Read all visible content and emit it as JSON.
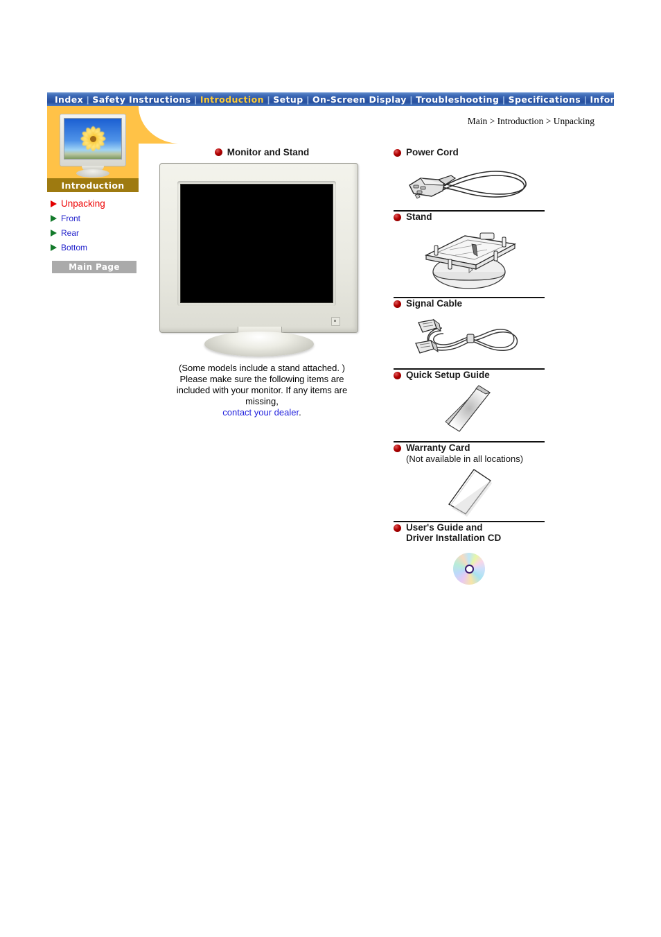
{
  "nav": {
    "items": [
      {
        "label": "Index",
        "active": false
      },
      {
        "label": "Safety Instructions",
        "active": false
      },
      {
        "label": "Introduction",
        "active": true
      },
      {
        "label": "Setup",
        "active": false
      },
      {
        "label": "On-Screen Display",
        "active": false
      },
      {
        "label": "Troubleshooting",
        "active": false
      },
      {
        "label": "Specifications",
        "active": false
      },
      {
        "label": "Information",
        "active": false
      }
    ],
    "separator": "|"
  },
  "sidebar": {
    "thumbnail_icon": "monitor-flower-thumbnail",
    "section_label": "Introduction",
    "items": [
      {
        "label": "Unpacking",
        "current": true
      },
      {
        "label": "Front",
        "current": false
      },
      {
        "label": "Rear",
        "current": false
      },
      {
        "label": "Bottom",
        "current": false
      }
    ],
    "main_page_button": "Main Page"
  },
  "breadcrumb": "Main > Introduction > Unpacking",
  "center": {
    "title": "Monitor and Stand",
    "illustration": "crt-monitor-front-view",
    "caption_line1": "(Some models include a stand attached. )",
    "caption_line2": "Please make sure the following items are",
    "caption_line3": "included with your monitor. If any items are",
    "caption_line4": "missing,",
    "caption_link": "contact your dealer",
    "caption_period": "."
  },
  "right_items": [
    {
      "title": "Power Cord",
      "subtitle": "",
      "illustration": "power-cord-icon"
    },
    {
      "title": "Stand",
      "subtitle": "",
      "illustration": "monitor-stand-icon"
    },
    {
      "title": "Signal Cable",
      "subtitle": "",
      "illustration": "signal-cable-icon"
    },
    {
      "title": "Quick Setup Guide",
      "subtitle": "",
      "illustration": "booklet-icon"
    },
    {
      "title": "Warranty Card",
      "subtitle": "(Not available in all locations)",
      "illustration": "card-icon"
    },
    {
      "title": "User's Guide and",
      "subtitle": "Driver Installation CD",
      "illustration": "cd-disc-icon"
    }
  ],
  "colors": {
    "nav_blue": "#2e57a6",
    "nav_active_text": "#ffcc33",
    "tab_orange": "#ffc247",
    "section_gold": "#9e7a10",
    "current_red": "#ee0000",
    "link_blue": "#2222cc",
    "bullet_red": "#b00000",
    "button_gray": "#aaaaaa"
  }
}
